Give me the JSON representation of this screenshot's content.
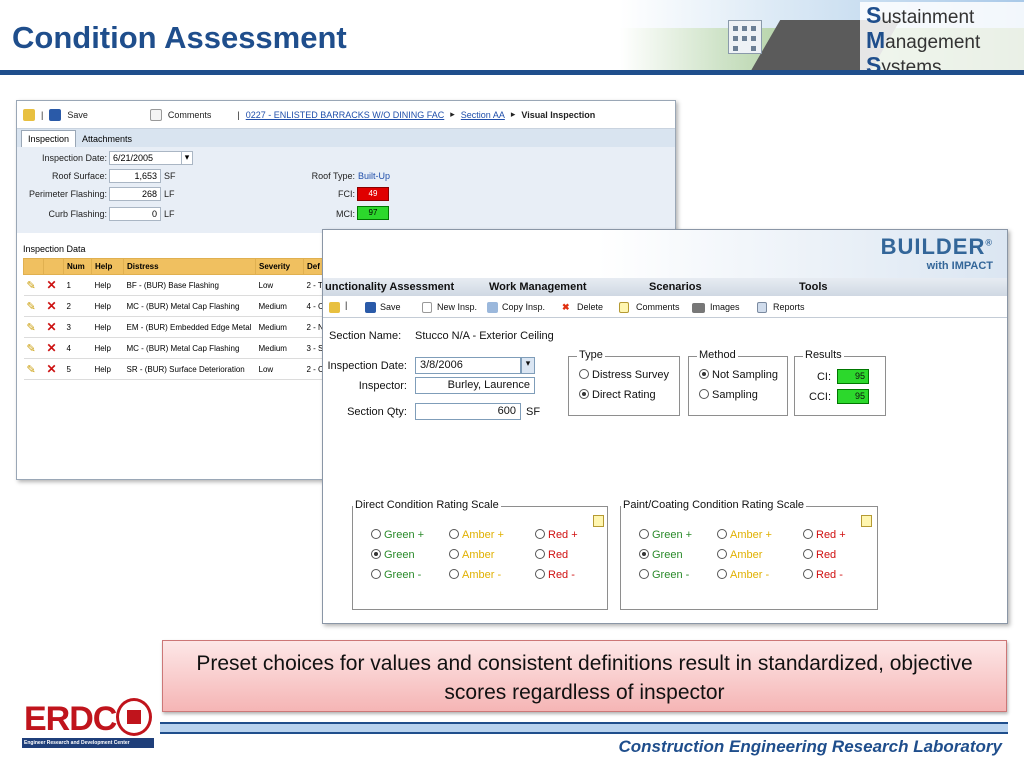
{
  "slide": {
    "title": "Condition Assessment",
    "logo_lines": [
      "ustainment",
      "anagement",
      "ystems"
    ],
    "logo_initials": [
      "S",
      "M",
      "S"
    ],
    "callout": "Preset choices for values and consistent definitions result in standardized, objective scores regardless of inspector",
    "footer": "Construction Engineering Research Laboratory",
    "erdc_word": "ERDC",
    "erdc_sub": "Engineer Research and Development Center"
  },
  "win1": {
    "toolbar": {
      "save": "Save",
      "comments": "Comments",
      "sep": "|",
      "crumb1": "0227 - ENLISTED BARRACKS W/O DINING FAC",
      "crumb2": "Section AA",
      "crumb3": "Visual Inspection"
    },
    "tabs": [
      "Inspection",
      "Attachments"
    ],
    "form": {
      "inspection_date_label": "Inspection Date:",
      "inspection_date": "6/21/2005",
      "roof_surface_label": "Roof Surface:",
      "roof_surface": "1,653",
      "roof_surface_unit": "SF",
      "perimeter_flashing_label": "Perimeter Flashing:",
      "perimeter_flashing": "268",
      "perimeter_unit": "LF",
      "curb_flashing_label": "Curb Flashing:",
      "curb_flashing": "0",
      "curb_unit": "LF",
      "roof_type_label": "Roof Type:",
      "roof_type": "Built-Up",
      "fci_label": "FCI:",
      "fci": "49",
      "mci_label": "MCI:",
      "mci": "97"
    },
    "inspection_data_title": "Inspection Data",
    "grid": {
      "headers": [
        "",
        "",
        "Num",
        "Help",
        "Distress",
        "Severity",
        "Def"
      ],
      "rows": [
        {
          "num": "1",
          "help": "Help",
          "distress": "BF - (BUR) Base Flashing",
          "severity": "Low",
          "def": "2 - T"
        },
        {
          "num": "2",
          "help": "Help",
          "distress": "MC - (BUR) Metal Cap Flashing",
          "severity": "Medium",
          "def": "4 - C"
        },
        {
          "num": "3",
          "help": "Help",
          "distress": "EM - (BUR) Embedded Edge Metal",
          "severity": "Medium",
          "def": "2 - N"
        },
        {
          "num": "4",
          "help": "Help",
          "distress": "MC - (BUR) Metal Cap Flashing",
          "severity": "Medium",
          "def": "3 - S"
        },
        {
          "num": "5",
          "help": "Help",
          "distress": "SR - (BUR) Surface Deterioration",
          "severity": "Low",
          "def": "2 - C"
        }
      ]
    }
  },
  "win2": {
    "brand": "BUILDER",
    "brand_mark": "®",
    "brand_sub": "with IMPACT",
    "menu": [
      "unctionality Assessment",
      "Work Management",
      "Scenarios",
      "Tools"
    ],
    "toolbar": [
      "Save",
      "New Insp.",
      "Copy Insp.",
      "Delete",
      "Comments",
      "Images",
      "Reports"
    ],
    "section_name_label": "Section Name:",
    "section_name": "Stucco N/A - Exterior Ceiling",
    "inspection_date_label": "Inspection Date:",
    "inspection_date": "3/8/2006",
    "inspector_label": "Inspector:",
    "inspector": "Burley, Laurence",
    "section_qty_label": "Section Qty:",
    "section_qty": "600",
    "section_qty_unit": "SF",
    "type": {
      "legend": "Type",
      "options": [
        "Distress Survey",
        "Direct Rating"
      ],
      "selected": 1
    },
    "method": {
      "legend": "Method",
      "options": [
        "Not Sampling",
        "Sampling"
      ],
      "selected": 0
    },
    "results": {
      "legend": "Results",
      "ci_label": "CI:",
      "ci": "95",
      "cci_label": "CCI:",
      "cci": "95"
    },
    "direct_scale": {
      "legend": "Direct Condition Rating Scale",
      "options": [
        [
          "Green +",
          "Amber +",
          "Red +"
        ],
        [
          "Green",
          "Amber",
          "Red"
        ],
        [
          "Green -",
          "Amber -",
          "Red -"
        ]
      ],
      "selected": "Green"
    },
    "paint_scale": {
      "legend": "Paint/Coating Condition Rating Scale",
      "options": [
        [
          "Green +",
          "Amber +",
          "Red +"
        ],
        [
          "Green",
          "Amber",
          "Red"
        ],
        [
          "Green -",
          "Amber -",
          "Red -"
        ]
      ],
      "selected": "Green"
    }
  },
  "colors": {
    "brand_blue": "#1f4e8c",
    "erdc_red": "#c0141c",
    "fci_red": "#e00000",
    "score_green": "#2cd82c"
  }
}
